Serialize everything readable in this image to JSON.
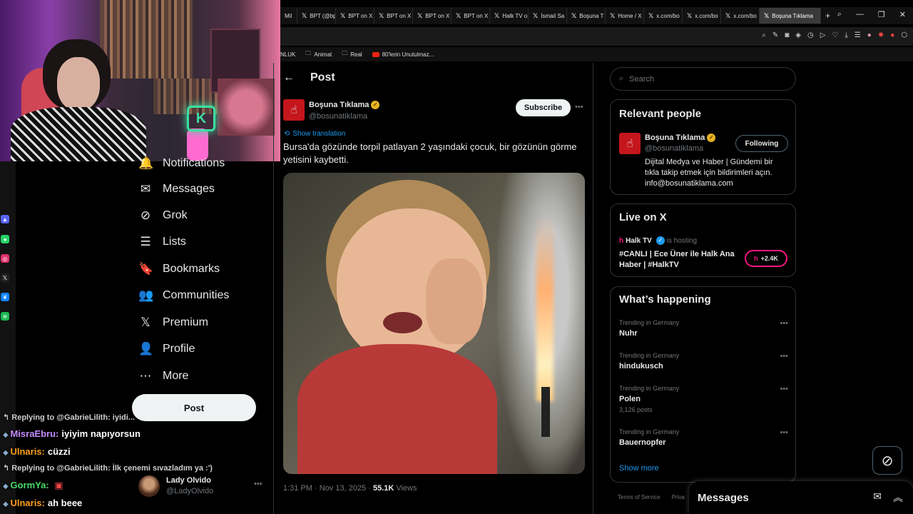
{
  "browser": {
    "tabs": [
      {
        "label": "Mil"
      },
      {
        "label": "BPT (@bp"
      },
      {
        "label": "BPT on X"
      },
      {
        "label": "BPT on X"
      },
      {
        "label": "BPT on X"
      },
      {
        "label": "BPT on X"
      },
      {
        "label": "Halk TV o"
      },
      {
        "label": "İsmail Sa"
      },
      {
        "label": "Boşuna T"
      },
      {
        "label": "Home / X"
      },
      {
        "label": "x.com/bo"
      },
      {
        "label": "x.com/bo"
      },
      {
        "label": "x.com/bo"
      },
      {
        "label": "Boşuna Tıklama"
      }
    ],
    "bookmarks": [
      "NLUK",
      "Animat",
      "Real",
      "80'lerin Unutulmaz..."
    ]
  },
  "webcam": {
    "logo_letter": "K"
  },
  "nav": {
    "items": [
      {
        "label": "Notifications",
        "icon": "bell"
      },
      {
        "label": "Messages",
        "icon": "envelope"
      },
      {
        "label": "Grok",
        "icon": "grok"
      },
      {
        "label": "Lists",
        "icon": "list"
      },
      {
        "label": "Bookmarks",
        "icon": "bookmark"
      },
      {
        "label": "Communities",
        "icon": "people"
      },
      {
        "label": "Premium",
        "icon": "x-logo"
      },
      {
        "label": "Profile",
        "icon": "person"
      },
      {
        "label": "More",
        "icon": "more-circle"
      }
    ],
    "post_button": "Post",
    "account": {
      "name": "Lady Olvido",
      "handle": "@LadyOlvido"
    }
  },
  "chat": [
    {
      "type": "reply",
      "text": "Replying to @GabrieLilith: iyidi..."
    },
    {
      "type": "msg",
      "user": "MisraEbru:",
      "text": "iyiyim napıyorsun",
      "color": "#c58cff"
    },
    {
      "type": "msg",
      "user": "Ulnaris:",
      "text": "cüzzi",
      "color": "#ff9f1c"
    },
    {
      "type": "reply",
      "text": "Replying to @GabrieLilith: İlk çenemi sıvazladım ya :')"
    },
    {
      "type": "msg",
      "user": "GormYa:",
      "text": "",
      "color": "#4ddc6a"
    },
    {
      "type": "msg",
      "user": "Ulnaris:",
      "text": "ah beee",
      "color": "#ff9f1c"
    }
  ],
  "post": {
    "header": "Post",
    "author_name": "Boşuna Tıklama",
    "author_handle": "@bosunatiklama",
    "subscribe": "Subscribe",
    "show_translation": "Show translation",
    "text": "Bursa'da gözünde torpil patlayan 2 yaşındaki çocuk, bir gözünün görme yetisini kaybetti.",
    "time": "1:31 PM · Nov 13, 2025 · ",
    "views_count": "55.1K",
    "views_label": " Views"
  },
  "right": {
    "search_placeholder": "Search",
    "relevant": {
      "title": "Relevant people",
      "name": "Boşuna Tıklama",
      "handle": "@bosunatiklama",
      "follow_label": "Following",
      "bio": "Dijital Medya ve Haber | Gündemi bir tıkla takip etmek için bildirimleri açın. info@bosunatiklama.com"
    },
    "live": {
      "title": "Live on X",
      "host": "Halk TV",
      "hosting": "is hosting",
      "stream_title": "#CANLI | Ece Üner ile Halk Ana Haber | #HalkTV",
      "count": "+2.4K"
    },
    "happening": {
      "title": "What’s happening",
      "trends": [
        {
          "category": "Trending in Germany",
          "name": "Nuhr",
          "posts": ""
        },
        {
          "category": "Trending in Germany",
          "name": "hindukusch",
          "posts": ""
        },
        {
          "category": "Trending in Germany",
          "name": "Polen",
          "posts": "3,126 posts"
        },
        {
          "category": "Trending in Germany",
          "name": "Bauernopfer",
          "posts": ""
        }
      ],
      "show_more": "Show more"
    },
    "footer": [
      "Terms of Service",
      "Priva"
    ],
    "messages_drawer": "Messages"
  },
  "colors": {
    "accent": "#1d9bf0",
    "live": "#f91880",
    "brand_red": "#c4161c"
  }
}
